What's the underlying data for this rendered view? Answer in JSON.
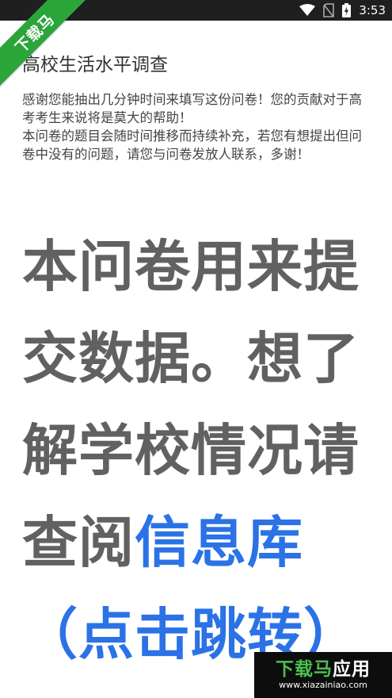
{
  "status_bar": {
    "time": "3:53"
  },
  "watermark": {
    "ribbon_text": "下载马",
    "brand_green": "下载马",
    "brand_white": "应用",
    "url": "www.xiazainiao.com"
  },
  "survey": {
    "title": "高校生活水平调查",
    "description_1": "感谢您能抽出几分钟时间来填写这份问卷！您的贡献对于高考考生来说将是莫大的帮助！",
    "description_2": "本问卷的题目会随时间推移而持续补充，若您有想提出但问卷中没有的问题，请您与问卷发放人联系，多谢！",
    "notice_text": "本问卷用来提交数据。想了解学校情况请查阅",
    "notice_link": "信息库（点击跳转）"
  },
  "colors": {
    "status_bar": "#1f1f1f",
    "ribbon": "#2aa53a",
    "notice_text": "#616161",
    "link": "#2b72e6"
  }
}
